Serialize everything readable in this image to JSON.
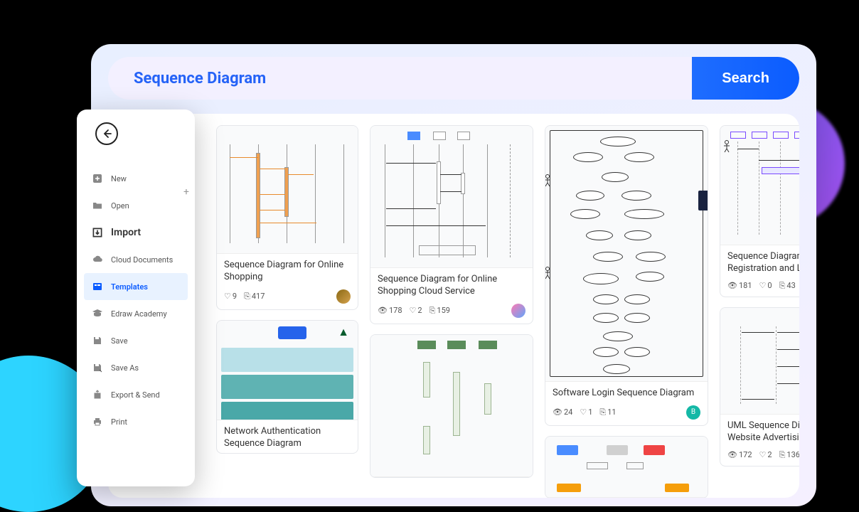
{
  "search": {
    "query": "Sequence Diagram",
    "button_label": "Search"
  },
  "sidebar": {
    "items": [
      {
        "label": "New"
      },
      {
        "label": "Open"
      },
      {
        "label": "Import"
      },
      {
        "label": "Cloud Documents"
      },
      {
        "label": "Templates"
      },
      {
        "label": "Edraw Academy"
      },
      {
        "label": "Save"
      },
      {
        "label": "Save As"
      },
      {
        "label": "Export & Send"
      },
      {
        "label": "Print"
      }
    ]
  },
  "templates": {
    "col1": [
      {
        "title": "Sequence Diagram for Online Shopping",
        "views": "",
        "likes": "9",
        "copies": "417"
      },
      {
        "title": "Network Authentication Sequence Diagram",
        "views": "",
        "likes": "",
        "copies": ""
      }
    ],
    "col2": [
      {
        "title": "Sequence Diagram for Online Shopping Cloud Service",
        "views": "178",
        "likes": "2",
        "copies": "159"
      },
      {
        "title": "",
        "views": "",
        "likes": "",
        "copies": ""
      }
    ],
    "col3": [
      {
        "title": "Software Login Sequence Diagram",
        "views": "24",
        "likes": "1",
        "copies": "11",
        "avatar_letter": "B"
      },
      {
        "title": "",
        "views": "",
        "likes": "",
        "copies": ""
      }
    ],
    "col4": [
      {
        "title": "Sequence Diagram for User Registration and Login P",
        "views": "181",
        "likes": "0",
        "copies": "43"
      },
      {
        "title": "UML Sequence Diagram Website Advertising App",
        "views": "172",
        "likes": "2",
        "copies": "136"
      }
    ]
  }
}
